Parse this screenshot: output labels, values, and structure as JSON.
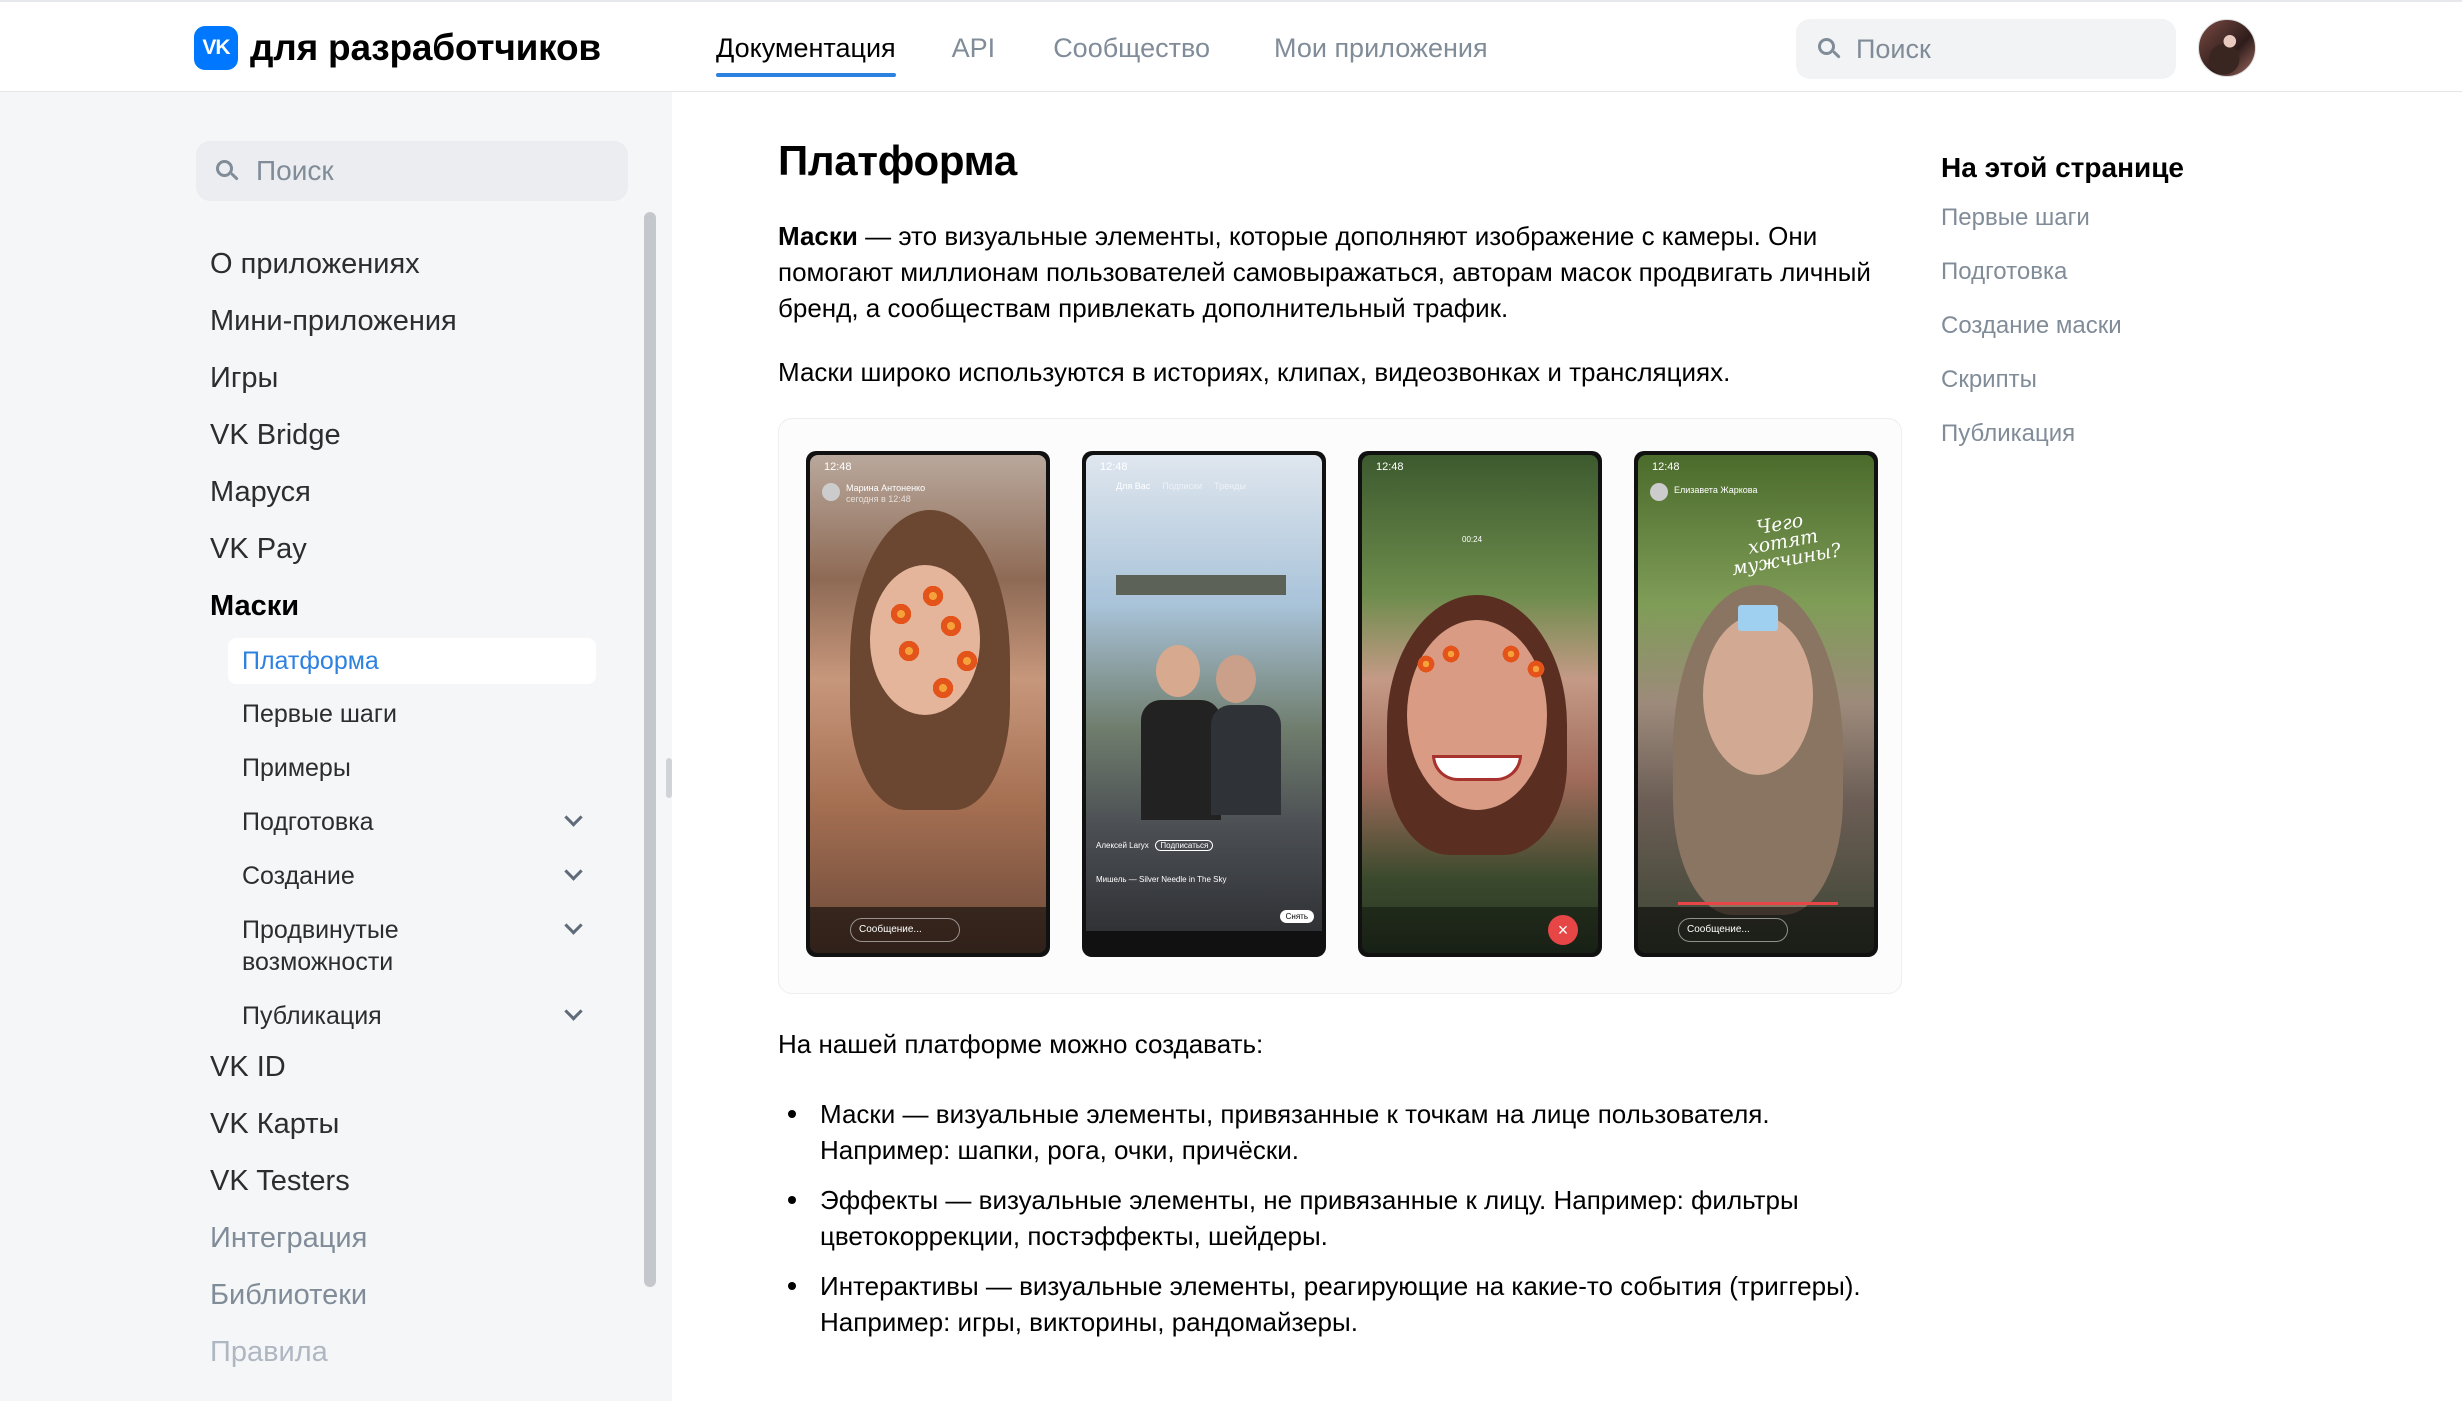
{
  "header": {
    "logo_badge": "VK",
    "logo_text": "для разработчиков",
    "nav": [
      "Документация",
      "API",
      "Сообщество",
      "Мои приложения"
    ],
    "active_nav": "Документация",
    "search_placeholder": "Поиск",
    "accent_color": "#2d81e0"
  },
  "sidebar": {
    "search_placeholder": "Поиск",
    "items": [
      {
        "label": "О приложениях"
      },
      {
        "label": "Мини-приложения"
      },
      {
        "label": "Игры"
      },
      {
        "label": "VK Bridge"
      },
      {
        "label": "Маруся"
      },
      {
        "label": "VK Pay"
      },
      {
        "label": "Маски",
        "expanded": true
      },
      {
        "label": "VK ID"
      },
      {
        "label": "VK Карты"
      },
      {
        "label": "VK Testers"
      },
      {
        "label": "Интеграция"
      },
      {
        "label": "Библиотеки"
      },
      {
        "label": "Правила"
      }
    ],
    "subitems": [
      {
        "label": "Платформа",
        "active": true
      },
      {
        "label": "Первые шаги"
      },
      {
        "label": "Примеры"
      },
      {
        "label": "Подготовка",
        "expandable": true
      },
      {
        "label": "Создание",
        "expandable": true
      },
      {
        "label_line1": "Продвинутые",
        "label_line2": "возможности",
        "expandable": true
      },
      {
        "label": "Публикация",
        "expandable": true
      }
    ]
  },
  "main": {
    "title": "Платформа",
    "intro_bold": "Маски",
    "intro_rest": " — это визуальные элементы, которые дополняют изображение с камеры. Они помогают миллионам пользователей самовыражаться, авторам масок продвигать личный бренд, а сообществам привлекать дополнительный трафик.",
    "usage": "Маски широко используются в историях, клипах, видеозвонках и трансляциях.",
    "figure": {
      "phones": [
        {
          "time": "12:48",
          "author": "Марина Антоненко",
          "subtitle": "сегодня в 12:48",
          "input": "Сообщение..."
        },
        {
          "time": "12:48",
          "tabs": [
            "Для Вас",
            "Подписки",
            "Тренды"
          ],
          "caption": "Алексей Laryx",
          "subscribe": "Подписаться",
          "track": "Мишель — Silver Needle in The Sky",
          "action": "Снять"
        },
        {
          "time": "12:48",
          "call_time": "00:24"
        },
        {
          "time": "12:48",
          "author": "Елизавета Жаркова",
          "handwriting": "Чего хотят мужчины?",
          "input": "Сообщение..."
        }
      ]
    },
    "can_create": "На нашей платформе можно создавать:",
    "bullets": [
      {
        "line1": "Маски — визуальные элементы, привязанные к точкам на лице пользователя.",
        "line2": "Например: шапки, рога, очки, причёски."
      },
      {
        "line1": "Эффекты — визуальные элементы, не привязанные к лицу. Например: фильтры",
        "line2": "цветокоррекции, постэффекты, шейдеры."
      },
      {
        "line1": "Интерактивы — визуальные элементы, реагирующие на какие-то события (триггеры).",
        "line2": "Например: игры, викторины, рандомайзеры."
      }
    ]
  },
  "toc": {
    "title": "На этой странице",
    "items": [
      "Первые шаги",
      "Подготовка",
      "Создание маски",
      "Скрипты",
      "Публикация"
    ]
  }
}
